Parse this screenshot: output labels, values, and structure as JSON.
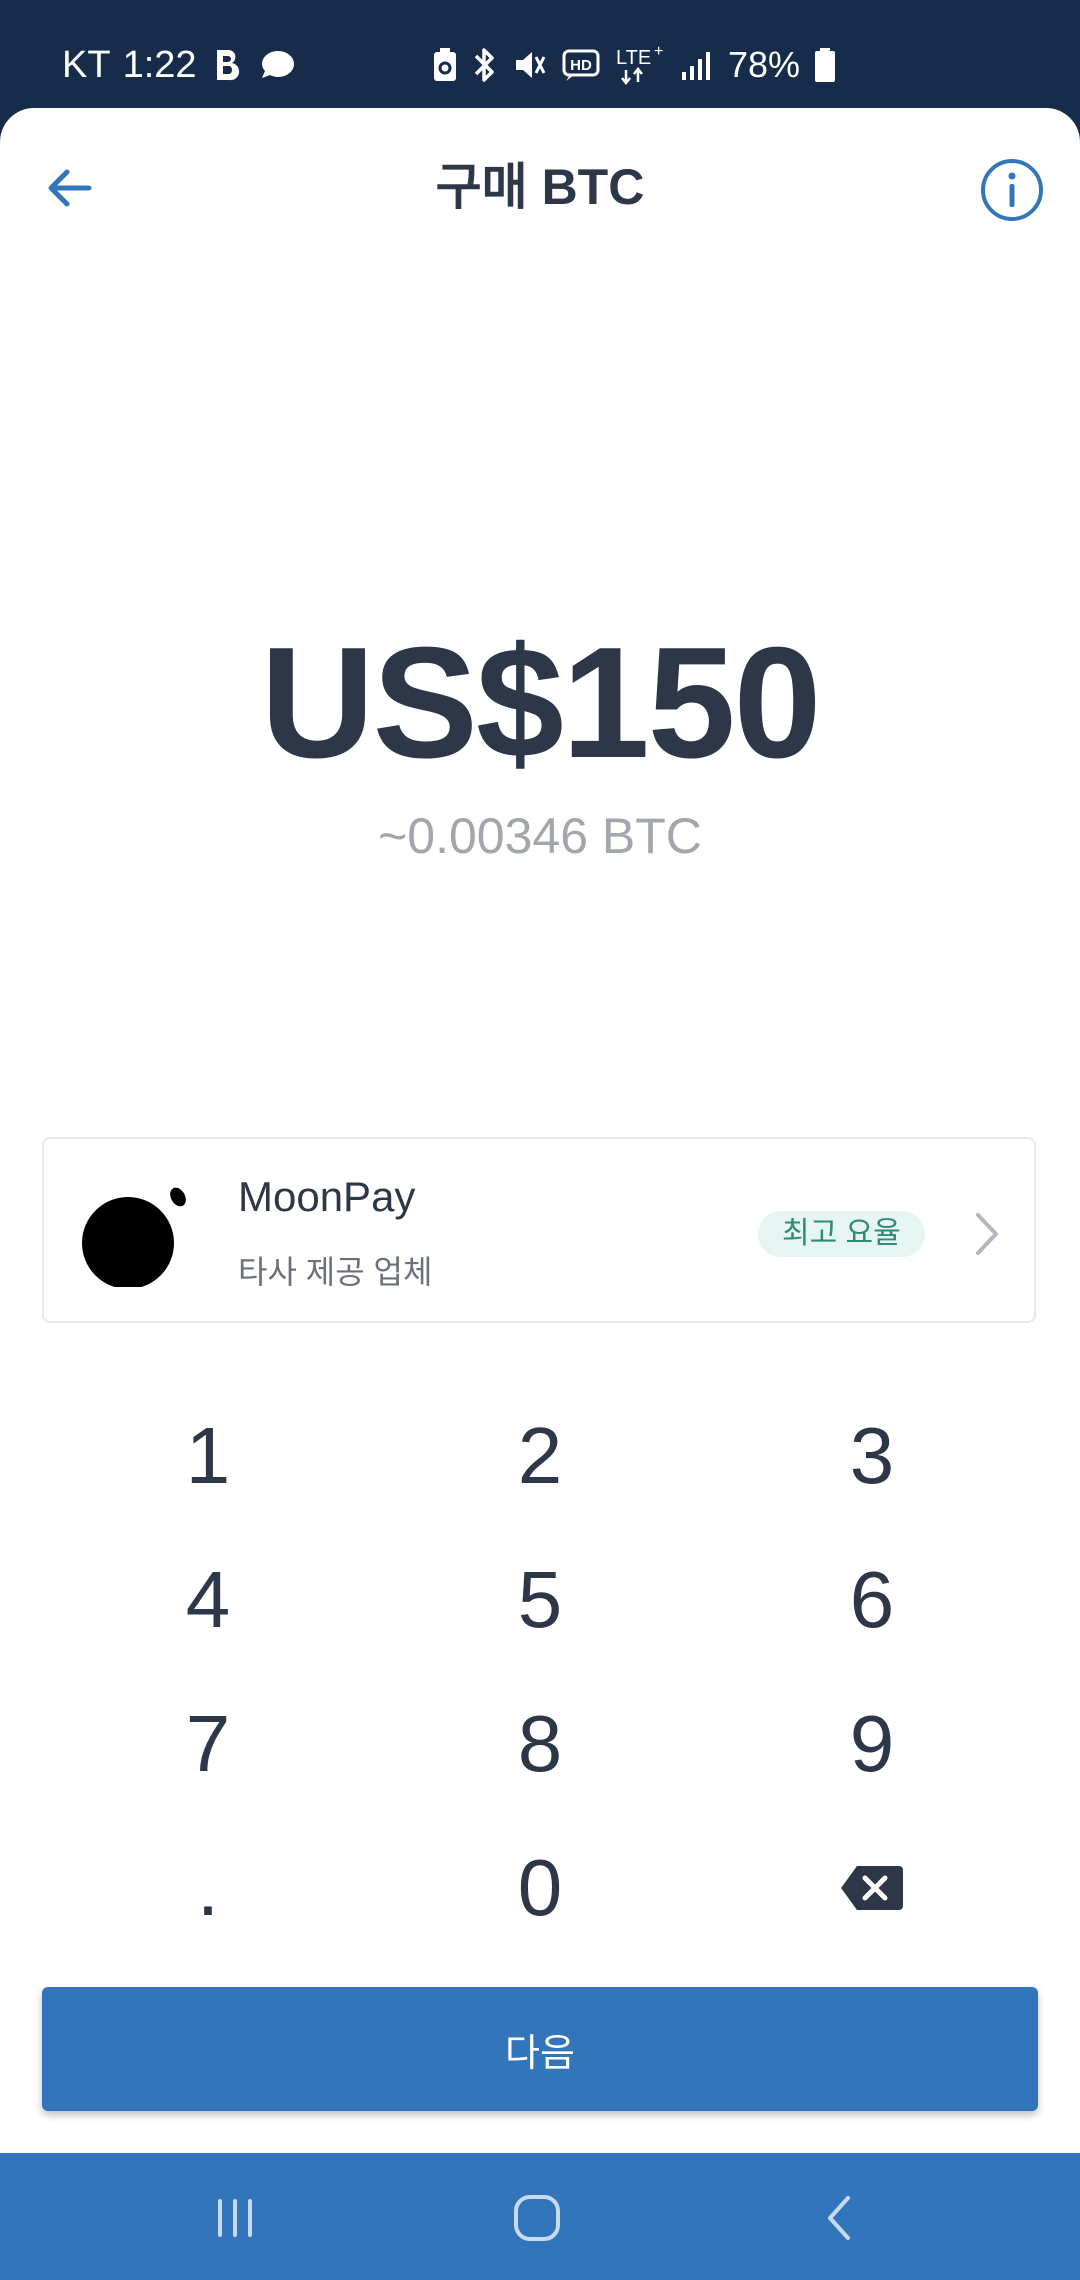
{
  "status_bar": {
    "carrier": "KT",
    "time": "1:22",
    "network": "LTE+",
    "battery": "78%"
  },
  "header": {
    "title": "구매 BTC",
    "back_icon": "arrow-left-icon",
    "info_icon": "info-circle-icon"
  },
  "amount": {
    "fiat": "US$150",
    "crypto": "~0.00346 BTC"
  },
  "provider": {
    "name": "MoonPay",
    "subtitle": "타사 제공 업체",
    "badge": "최고 요율"
  },
  "keypad": {
    "keys": [
      "1",
      "2",
      "3",
      "4",
      "5",
      "6",
      "7",
      "8",
      "9",
      ".",
      "0"
    ],
    "backspace_icon": "backspace-icon"
  },
  "next_button": {
    "label": "다음"
  },
  "colors": {
    "status_bar_bg": "#172c4a",
    "primary": "#3375bb",
    "text_dark": "#2e3748",
    "text_muted": "#a3a7ad",
    "badge_bg": "#e6f5f1",
    "badge_text": "#2c8c75"
  }
}
